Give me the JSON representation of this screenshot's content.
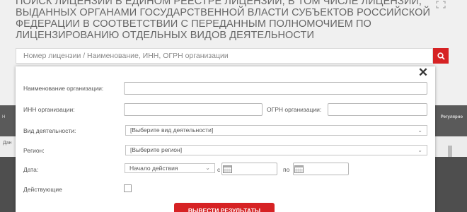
{
  "page": {
    "title": "Поиск лицензий в едином реестре лицензий, в том числе лицензий, выданных органами государственной власти субъектов Российской Федерации в соответствии с переданным полномочием по лицензированию отдельных видов деятельности"
  },
  "search": {
    "placeholder": "Номер лицензии / Наименование, ИНН, ОГРН организации"
  },
  "background": {
    "band_right_text": "Регулярно",
    "band_left_text": "Н",
    "row_text": "Дан"
  },
  "form": {
    "org_name_label": "Наименование организации:",
    "inn_label": "ИНН организации:",
    "ogrn_label": "ОГРН организации:",
    "activity_label": "Вид деятельности:",
    "activity_selected": "[Выберите вид деятельности]",
    "region_label": "Регион:",
    "region_selected": "[Выберите регион]",
    "date_label": "Дата:",
    "date_type_selected": "Начало действия",
    "from_label": "с",
    "to_label": "по",
    "active_label": "Действующие",
    "active_checked": false,
    "submit_label": "Вывести результаты"
  },
  "colors": {
    "accent": "#d62224",
    "dark_band": "#5a5a5a"
  },
  "icons": {
    "search": "search-icon",
    "close": "close-icon",
    "expand": "expand-icon",
    "calendar": "calendar-icon",
    "caret": "chevron-down-icon"
  }
}
